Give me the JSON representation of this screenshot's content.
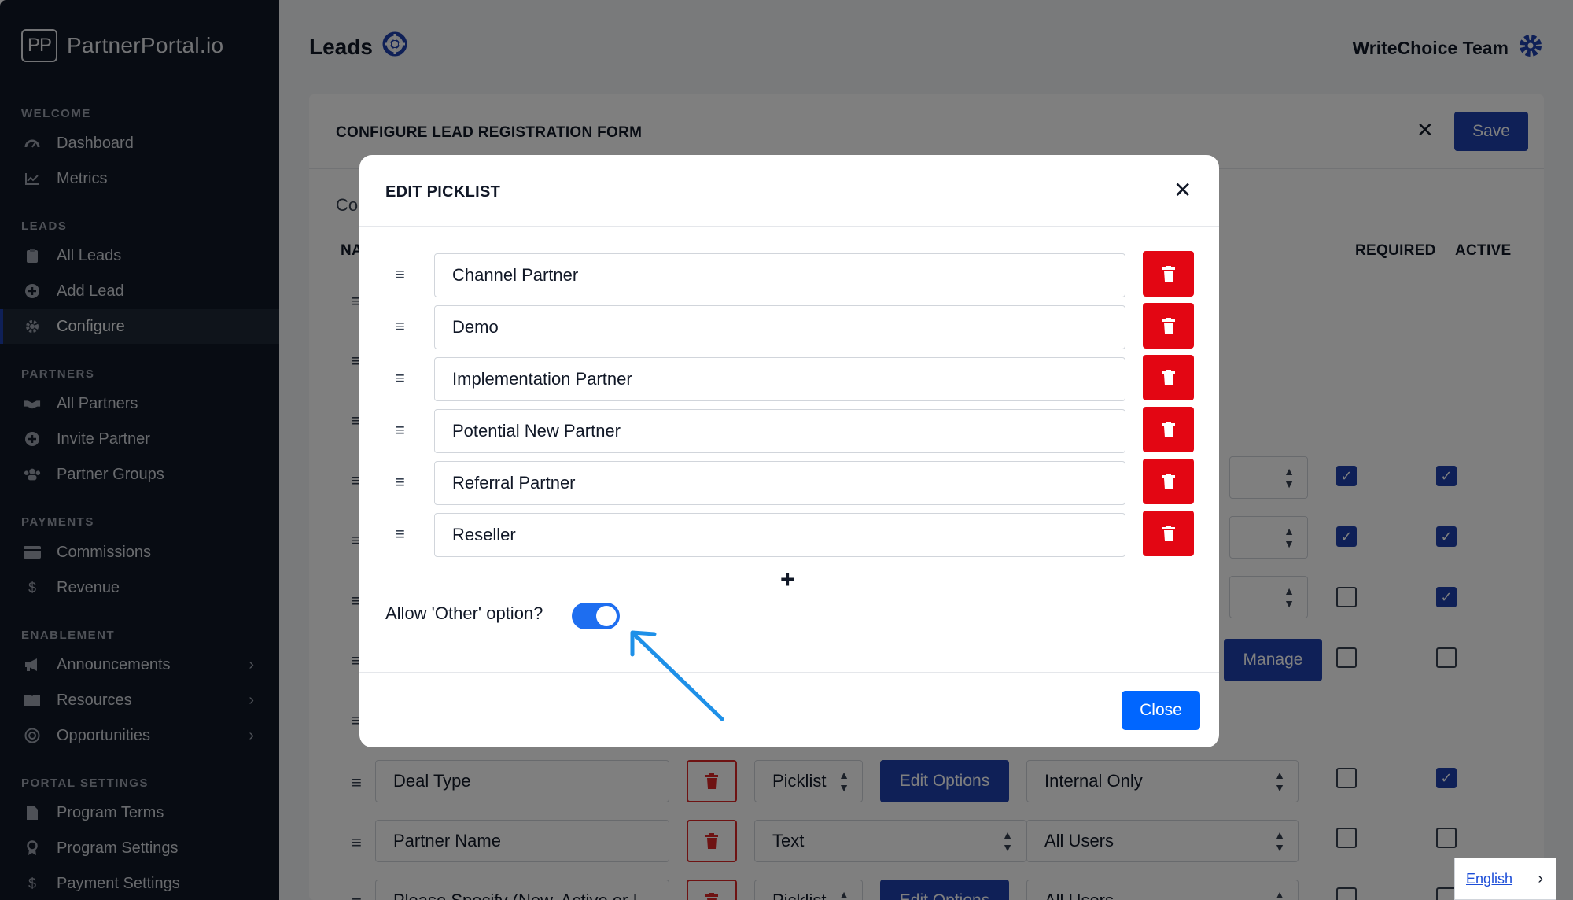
{
  "brand": {
    "logo_mark": "PP",
    "name": "PartnerPortal.io"
  },
  "sidebar": {
    "sections": [
      {
        "title": "WELCOME",
        "items": [
          {
            "label": "Dashboard",
            "icon": "gauge-icon"
          },
          {
            "label": "Metrics",
            "icon": "chart-line-icon"
          }
        ]
      },
      {
        "title": "LEADS",
        "items": [
          {
            "label": "All Leads",
            "icon": "clipboard-icon"
          },
          {
            "label": "Add Lead",
            "icon": "plus-circle-icon"
          },
          {
            "label": "Configure",
            "icon": "gear-icon",
            "active": true
          }
        ]
      },
      {
        "title": "PARTNERS",
        "items": [
          {
            "label": "All Partners",
            "icon": "handshake-icon"
          },
          {
            "label": "Invite Partner",
            "icon": "plus-circle-icon"
          },
          {
            "label": "Partner Groups",
            "icon": "users-icon"
          }
        ]
      },
      {
        "title": "PAYMENTS",
        "items": [
          {
            "label": "Commissions",
            "icon": "credit-card-icon"
          },
          {
            "label": "Revenue",
            "icon": "dollar-icon"
          }
        ]
      },
      {
        "title": "ENABLEMENT",
        "items": [
          {
            "label": "Announcements",
            "icon": "megaphone-icon"
          },
          {
            "label": "Resources",
            "icon": "book-icon"
          },
          {
            "label": "Opportunities",
            "icon": "target-icon"
          }
        ]
      },
      {
        "title": "PORTAL SETTINGS",
        "items": [
          {
            "label": "Program Terms",
            "icon": "file-icon"
          },
          {
            "label": "Program Settings",
            "icon": "award-icon"
          },
          {
            "label": "Payment Settings",
            "icon": "dollar-icon"
          }
        ]
      }
    ]
  },
  "header": {
    "title": "Leads",
    "team": "WriteChoice Team"
  },
  "card": {
    "title": "CONFIGURE LEAD REGISTRATION FORM",
    "save_label": "Save",
    "subtitle_fragment": "Co",
    "col_name_fragment": "NA",
    "col_required": "REQUIRED",
    "col_active": "ACTIVE",
    "manage_label": "Manage",
    "rows": [
      {
        "name": "Deal Type",
        "type": "Picklist",
        "button": "Edit Options",
        "visibility": "Internal Only",
        "required": false,
        "active": true
      },
      {
        "name": "Partner Name",
        "type": "Text",
        "button": "",
        "visibility": "All Users",
        "required": false,
        "active": false
      },
      {
        "name": "Please Specify (New, Active or I",
        "type": "Picklist",
        "button": "Edit Options",
        "visibility": "All Users",
        "required": false,
        "active": false
      }
    ],
    "upper_checks": [
      {
        "required": true,
        "active": true
      },
      {
        "required": true,
        "active": true
      },
      {
        "required": false,
        "active": true
      },
      {
        "required": false,
        "active": false
      }
    ]
  },
  "modal": {
    "title": "EDIT PICKLIST",
    "options": [
      "Channel Partner",
      "Demo",
      "Implementation Partner",
      "Potential New Partner",
      "Referral Partner",
      "Reseller"
    ],
    "allow_other_label": "Allow 'Other' option?",
    "allow_other": true,
    "close_label": "Close"
  },
  "language": {
    "label": "English"
  },
  "colors": {
    "sidebar_bg": "#111827",
    "primary": "#1e40af",
    "danger": "#e30613",
    "toggle_on": "#1e6ef0",
    "annotation_arrow": "#1e90e8"
  }
}
